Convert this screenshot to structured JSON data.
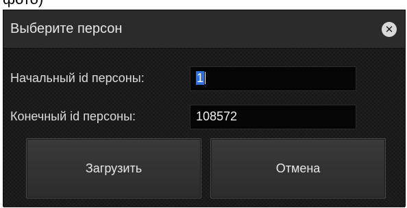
{
  "window": {
    "title": "Выберите персон",
    "top_clipped_text": "фото)"
  },
  "form": {
    "start_id_label": "Начальный id персоны:",
    "start_id_value": "1",
    "end_id_label": "Конечный id персоны:",
    "end_id_value": "108572"
  },
  "buttons": {
    "load_label": "Загрузить",
    "cancel_label": "Отмена"
  },
  "icons": {
    "close": "close-icon"
  },
  "colors": {
    "dialog_bg": "#1e1e1e",
    "titlebar_bg": "#2b2b2b",
    "field_bg": "#050505",
    "text": "#e6e6e6",
    "selection": "#2f6fde"
  }
}
